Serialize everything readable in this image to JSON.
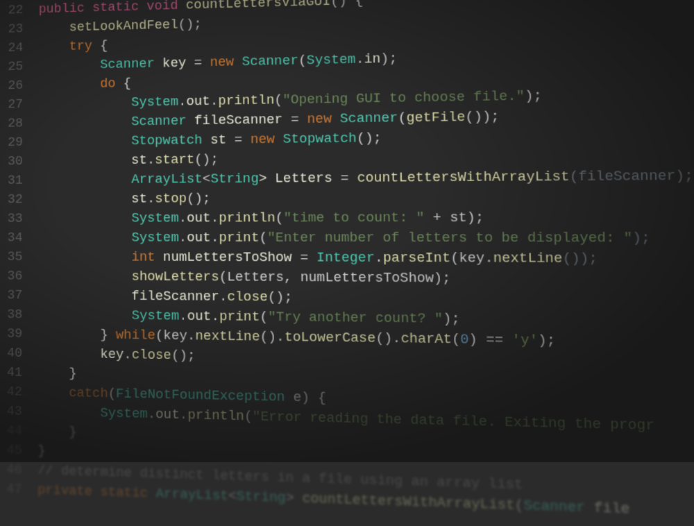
{
  "lines": [
    {
      "n": 22,
      "cls": "blurtop",
      "tokens": [
        {
          "t": "public",
          "c": "strong-kw"
        },
        {
          "t": " ",
          "c": "punc"
        },
        {
          "t": "static",
          "c": "strong-kw"
        },
        {
          "t": " ",
          "c": "punc"
        },
        {
          "t": "void",
          "c": "strong-kw"
        },
        {
          "t": " ",
          "c": "punc"
        },
        {
          "t": "countLettersViaGUI",
          "c": "func"
        },
        {
          "t": "() {",
          "c": "punc"
        }
      ]
    },
    {
      "n": 23,
      "cls": "blurtop",
      "tokens": [
        {
          "t": "    setLookAndFeel",
          "c": "func"
        },
        {
          "t": "();",
          "c": "punc"
        }
      ]
    },
    {
      "n": 24,
      "cls": "blurmid",
      "tokens": [
        {
          "t": "    ",
          "c": "punc"
        },
        {
          "t": "try",
          "c": "kw"
        },
        {
          "t": " {",
          "c": "punc"
        }
      ]
    },
    {
      "n": 25,
      "cls": "blurmid",
      "tokens": [
        {
          "t": "        ",
          "c": "punc"
        },
        {
          "t": "Scanner",
          "c": "type"
        },
        {
          "t": " key ",
          "c": "id"
        },
        {
          "t": "=",
          "c": "op"
        },
        {
          "t": " ",
          "c": "punc"
        },
        {
          "t": "new",
          "c": "kw"
        },
        {
          "t": " ",
          "c": "punc"
        },
        {
          "t": "Scanner",
          "c": "type"
        },
        {
          "t": "(",
          "c": "punc"
        },
        {
          "t": "System",
          "c": "type"
        },
        {
          "t": ".",
          "c": "punc"
        },
        {
          "t": "in",
          "c": "id"
        },
        {
          "t": ");",
          "c": "punc"
        }
      ]
    },
    {
      "n": 26,
      "cls": "",
      "tokens": [
        {
          "t": "        ",
          "c": "punc"
        },
        {
          "t": "do",
          "c": "kw"
        },
        {
          "t": " {",
          "c": "punc"
        }
      ]
    },
    {
      "n": 27,
      "cls": "",
      "tokens": [
        {
          "t": "            ",
          "c": "punc"
        },
        {
          "t": "System",
          "c": "type"
        },
        {
          "t": ".",
          "c": "punc"
        },
        {
          "t": "out",
          "c": "id"
        },
        {
          "t": ".",
          "c": "punc"
        },
        {
          "t": "println",
          "c": "func"
        },
        {
          "t": "(",
          "c": "punc"
        },
        {
          "t": "\"Opening GUI to choose file.\"",
          "c": "str"
        },
        {
          "t": ");",
          "c": "punc"
        }
      ]
    },
    {
      "n": 28,
      "cls": "",
      "tokens": [
        {
          "t": "            ",
          "c": "punc"
        },
        {
          "t": "Scanner",
          "c": "type"
        },
        {
          "t": " fileScanner ",
          "c": "id"
        },
        {
          "t": "=",
          "c": "op"
        },
        {
          "t": " ",
          "c": "punc"
        },
        {
          "t": "new",
          "c": "kw"
        },
        {
          "t": " ",
          "c": "punc"
        },
        {
          "t": "Scanner",
          "c": "type"
        },
        {
          "t": "(",
          "c": "punc"
        },
        {
          "t": "getFile",
          "c": "func"
        },
        {
          "t": "());",
          "c": "punc"
        }
      ]
    },
    {
      "n": 29,
      "cls": "",
      "tokens": [
        {
          "t": "            ",
          "c": "punc"
        },
        {
          "t": "Stopwatch",
          "c": "type"
        },
        {
          "t": " st ",
          "c": "id"
        },
        {
          "t": "=",
          "c": "op"
        },
        {
          "t": " ",
          "c": "punc"
        },
        {
          "t": "new",
          "c": "kw"
        },
        {
          "t": " ",
          "c": "punc"
        },
        {
          "t": "Stopwatch",
          "c": "type"
        },
        {
          "t": "();",
          "c": "punc"
        }
      ]
    },
    {
      "n": 30,
      "cls": "",
      "tokens": [
        {
          "t": "            st",
          "c": "id"
        },
        {
          "t": ".",
          "c": "punc"
        },
        {
          "t": "start",
          "c": "func"
        },
        {
          "t": "();",
          "c": "punc"
        }
      ]
    },
    {
      "n": 31,
      "cls": "",
      "tokens": [
        {
          "t": "            ",
          "c": "punc"
        },
        {
          "t": "ArrayList",
          "c": "type"
        },
        {
          "t": "<",
          "c": "punc"
        },
        {
          "t": "String",
          "c": "type"
        },
        {
          "t": "> Letters ",
          "c": "id"
        },
        {
          "t": "=",
          "c": "op"
        },
        {
          "t": " ",
          "c": "punc"
        },
        {
          "t": "countLettersWithArrayList",
          "c": "func"
        },
        {
          "t": "(fileScanner);",
          "c": "dim"
        }
      ]
    },
    {
      "n": 32,
      "cls": "",
      "tokens": [
        {
          "t": "            st",
          "c": "id"
        },
        {
          "t": ".",
          "c": "punc"
        },
        {
          "t": "stop",
          "c": "func"
        },
        {
          "t": "();",
          "c": "punc"
        }
      ]
    },
    {
      "n": 33,
      "cls": "",
      "tokens": [
        {
          "t": "            ",
          "c": "punc"
        },
        {
          "t": "System",
          "c": "type"
        },
        {
          "t": ".",
          "c": "punc"
        },
        {
          "t": "out",
          "c": "id"
        },
        {
          "t": ".",
          "c": "punc"
        },
        {
          "t": "println",
          "c": "func"
        },
        {
          "t": "(",
          "c": "punc"
        },
        {
          "t": "\"time to count: \"",
          "c": "str"
        },
        {
          "t": " + st);",
          "c": "punc"
        }
      ]
    },
    {
      "n": 34,
      "cls": "",
      "tokens": [
        {
          "t": "            ",
          "c": "punc"
        },
        {
          "t": "System",
          "c": "type"
        },
        {
          "t": ".",
          "c": "punc"
        },
        {
          "t": "out",
          "c": "id"
        },
        {
          "t": ".",
          "c": "punc"
        },
        {
          "t": "print",
          "c": "func"
        },
        {
          "t": "(",
          "c": "punc"
        },
        {
          "t": "\"Enter number of letters to be displayed: \"",
          "c": "str"
        },
        {
          "t": ");",
          "c": "dim"
        }
      ]
    },
    {
      "n": 35,
      "cls": "",
      "tokens": [
        {
          "t": "            ",
          "c": "punc"
        },
        {
          "t": "int",
          "c": "kw"
        },
        {
          "t": " numLettersToShow ",
          "c": "id"
        },
        {
          "t": "=",
          "c": "op"
        },
        {
          "t": " ",
          "c": "punc"
        },
        {
          "t": "Integer",
          "c": "type"
        },
        {
          "t": ".",
          "c": "punc"
        },
        {
          "t": "parseInt",
          "c": "func"
        },
        {
          "t": "(key.",
          "c": "punc"
        },
        {
          "t": "nextLine",
          "c": "func"
        },
        {
          "t": "());",
          "c": "dim"
        }
      ]
    },
    {
      "n": 36,
      "cls": "",
      "tokens": [
        {
          "t": "            ",
          "c": "punc"
        },
        {
          "t": "showLetters",
          "c": "func"
        },
        {
          "t": "(Letters, numLettersToShow);",
          "c": "punc"
        }
      ]
    },
    {
      "n": 37,
      "cls": "",
      "tokens": [
        {
          "t": "            fileScanner",
          "c": "id"
        },
        {
          "t": ".",
          "c": "punc"
        },
        {
          "t": "close",
          "c": "func"
        },
        {
          "t": "();",
          "c": "punc"
        }
      ]
    },
    {
      "n": 38,
      "cls": "",
      "tokens": [
        {
          "t": "            ",
          "c": "punc"
        },
        {
          "t": "System",
          "c": "type"
        },
        {
          "t": ".",
          "c": "punc"
        },
        {
          "t": "out",
          "c": "id"
        },
        {
          "t": ".",
          "c": "punc"
        },
        {
          "t": "print",
          "c": "func"
        },
        {
          "t": "(",
          "c": "punc"
        },
        {
          "t": "\"Try another count? \"",
          "c": "str"
        },
        {
          "t": ");",
          "c": "punc"
        }
      ]
    },
    {
      "n": 39,
      "cls": "",
      "tokens": [
        {
          "t": "        } ",
          "c": "punc"
        },
        {
          "t": "while",
          "c": "kw"
        },
        {
          "t": "(key.",
          "c": "punc"
        },
        {
          "t": "nextLine",
          "c": "func"
        },
        {
          "t": "().",
          "c": "punc"
        },
        {
          "t": "toLowerCase",
          "c": "func"
        },
        {
          "t": "().",
          "c": "punc"
        },
        {
          "t": "charAt",
          "c": "func"
        },
        {
          "t": "(",
          "c": "punc"
        },
        {
          "t": "0",
          "c": "num"
        },
        {
          "t": ") ",
          "c": "punc"
        },
        {
          "t": "==",
          "c": "op"
        },
        {
          "t": " ",
          "c": "punc"
        },
        {
          "t": "'y'",
          "c": "str"
        },
        {
          "t": ");",
          "c": "punc"
        }
      ]
    },
    {
      "n": 40,
      "cls": "",
      "tokens": [
        {
          "t": "        key",
          "c": "id"
        },
        {
          "t": ".",
          "c": "punc"
        },
        {
          "t": "close",
          "c": "func"
        },
        {
          "t": "();",
          "c": "punc"
        }
      ]
    },
    {
      "n": 41,
      "cls": "",
      "tokens": [
        {
          "t": "    }",
          "c": "punc"
        }
      ]
    },
    {
      "n": 42,
      "cls": "dim",
      "tokens": [
        {
          "t": "    ",
          "c": "punc"
        },
        {
          "t": "catch",
          "c": "kw"
        },
        {
          "t": "(",
          "c": "punc"
        },
        {
          "t": "FileNotFoundException",
          "c": "type"
        },
        {
          "t": " e) {",
          "c": "punc"
        }
      ]
    },
    {
      "n": 43,
      "cls": "dim",
      "tokens": [
        {
          "t": "        ",
          "c": "punc"
        },
        {
          "t": "System",
          "c": "type"
        },
        {
          "t": ".",
          "c": "punc"
        },
        {
          "t": "out",
          "c": "id"
        },
        {
          "t": ".",
          "c": "punc"
        },
        {
          "t": "println",
          "c": "func"
        },
        {
          "t": "(",
          "c": "punc"
        },
        {
          "t": "\"Error reading the data file. Exiting the progr",
          "c": "str"
        }
      ]
    },
    {
      "n": 44,
      "cls": "dim2",
      "tokens": [
        {
          "t": "    }",
          "c": "punc"
        }
      ]
    },
    {
      "n": 45,
      "cls": "dim2",
      "tokens": [
        {
          "t": "}",
          "c": "punc"
        }
      ]
    },
    {
      "n": 46,
      "cls": "dim3",
      "tokens": [
        {
          "t": "// determine distinct letters in a file using an array list",
          "c": "cmnt"
        }
      ]
    },
    {
      "n": 47,
      "cls": "dim3",
      "tokens": [
        {
          "t": "private",
          "c": "kw"
        },
        {
          "t": " ",
          "c": "punc"
        },
        {
          "t": "static",
          "c": "kw"
        },
        {
          "t": " ",
          "c": "punc"
        },
        {
          "t": "ArrayList",
          "c": "type"
        },
        {
          "t": "<",
          "c": "punc"
        },
        {
          "t": "String",
          "c": "type"
        },
        {
          "t": "> ",
          "c": "punc"
        },
        {
          "t": "countLettersWithArrayList",
          "c": "func"
        },
        {
          "t": "(",
          "c": "punc"
        },
        {
          "t": "Scanner",
          "c": "type"
        },
        {
          "t": " file",
          "c": "id"
        }
      ]
    }
  ]
}
